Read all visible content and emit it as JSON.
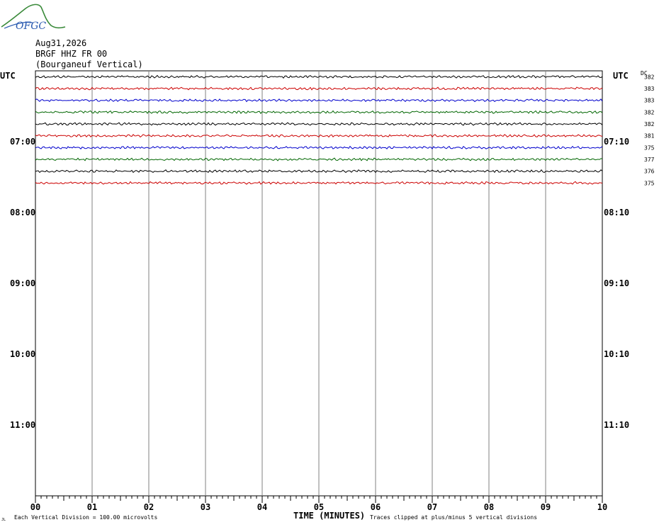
{
  "header": {
    "logo_text": "OFGC",
    "date": "Aug31,2026",
    "station": "BRGF HHZ FR 00",
    "location": "(Bourganeuf Vertical)"
  },
  "axes": {
    "left_label": "UTC",
    "right_label": "UTC",
    "dc_label": "DC",
    "left_hours": [
      "07:00",
      "08:00",
      "09:00",
      "10:00",
      "11:00"
    ],
    "right_hours": [
      "07:10",
      "08:10",
      "09:10",
      "10:10",
      "11:10"
    ],
    "minute_ticks": [
      "00",
      "01",
      "02",
      "03",
      "04",
      "05",
      "06",
      "07",
      "08",
      "09",
      "10"
    ],
    "xlabel": "TIME (MINUTES)"
  },
  "footer": {
    "scale_note": "Each Vertical Division =  100.00 microvolts",
    "clip_note": "Traces clipped at plus/minus 5 vertical divisions",
    "corner_mark": "JL"
  },
  "chart_data": {
    "type": "line",
    "title": "BRGF HHZ FR 00 (Bourganeuf Vertical)",
    "xlabel": "TIME (MINUTES)",
    "xlim": [
      0,
      10
    ],
    "rows_total": 36,
    "rows_recorded": 10,
    "trace_colors": [
      "#000000",
      "#cc0000",
      "#0000cc",
      "#006600"
    ],
    "traces": [
      {
        "dc": 382
      },
      {
        "dc": 383
      },
      {
        "dc": 383
      },
      {
        "dc": 382
      },
      {
        "dc": 382
      },
      {
        "dc": 381
      },
      {
        "dc": 375
      },
      {
        "dc": 377
      },
      {
        "dc": 376
      },
      {
        "dc": 375
      }
    ]
  }
}
